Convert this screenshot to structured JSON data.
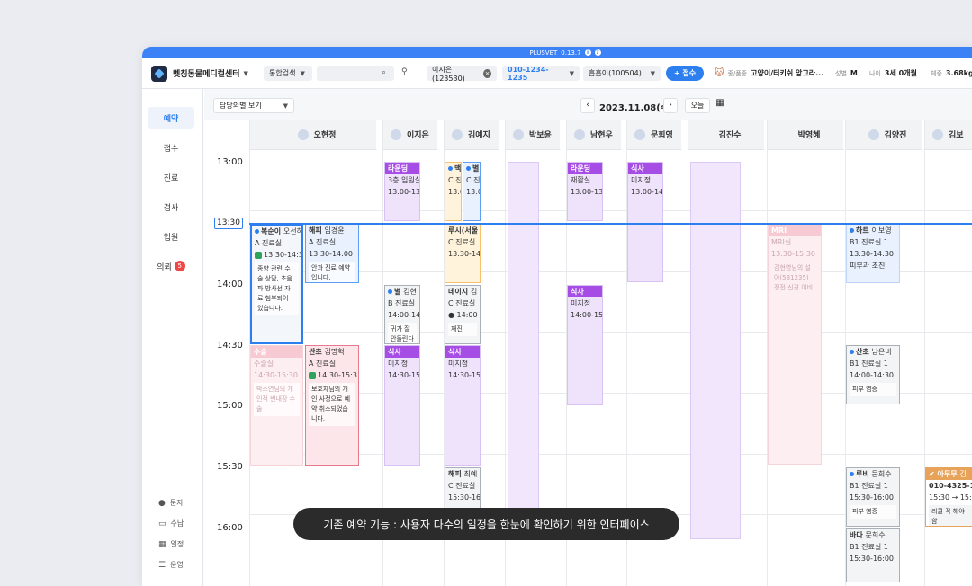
{
  "app": {
    "name": "PLUSVET",
    "version": "0.13.7"
  },
  "header": {
    "hospital": "벳칭동물메디컬센터",
    "search_type": "통합검색",
    "search_placeholder": "",
    "owner": "이지은(123530)",
    "phone": "010-1234-1235",
    "pet": "흡흡이(100504)",
    "add_label": "+ 접수",
    "species_label": "종/품종",
    "species_value": "고양이/터키쉬 앙고라...",
    "sex_label": "성별",
    "sex_value": "M",
    "age_label": "나이",
    "age_value": "3세 0개월",
    "weight_label": "체중",
    "weight_value": "3.68kg"
  },
  "sidebar": {
    "items": [
      {
        "label": "예약"
      },
      {
        "label": "접수"
      },
      {
        "label": "진료"
      },
      {
        "label": "검사"
      },
      {
        "label": "입원"
      },
      {
        "label": "의뢰",
        "badge": "5"
      }
    ],
    "sub_items": [
      {
        "label": "문자",
        "icon": "chat-icon"
      },
      {
        "label": "수납",
        "icon": "card-icon"
      },
      {
        "label": "일정",
        "icon": "calendar-icon"
      },
      {
        "label": "운영",
        "icon": "list-icon"
      }
    ]
  },
  "toolbar": {
    "view": "담당의별 보기",
    "date": "2023.11.08(수)",
    "today": "오늘"
  },
  "times": [
    "13:00",
    "13:30",
    "14:00",
    "14:30",
    "15:00",
    "15:30",
    "16:00"
  ],
  "now": "13:30",
  "doctors": [
    "오현정",
    "이지은",
    "김예지",
    "박보윤",
    "남현우",
    "문희영",
    "김진수",
    "박영혜",
    "김양진",
    "김보"
  ],
  "cards": {
    "c1": {
      "title": "복순이",
      "owner": "오선하",
      "room": "A 진료실",
      "time": "13:30-14:3",
      "note": "종양 관련 수술 상담, 초음파 방사선 자료 첨부되어 있습니다."
    },
    "c2": {
      "title": "해피",
      "owner": "임경윤",
      "room": "A 진료실",
      "time": "13:30-14:00",
      "note": "안과 진료 예약입니다."
    },
    "c3": {
      "title": "수술",
      "room": "수술실",
      "time": "14:30-15:30",
      "note": "박소연님의 개인적 변내장 수술"
    },
    "c4": {
      "title": "싼초",
      "owner": "김명혁",
      "room": "A 진료실",
      "time": "14:30-15:3",
      "note": "보호자님의 개인 사정으로 예약 취소되었습니다."
    },
    "c5": {
      "title": "라운딩",
      "room": "3층 입원실",
      "time": "13:00-13"
    },
    "c6": {
      "title": "별",
      "owner": "김현",
      "room": "B 진료실",
      "time": "14:00-14",
      "note": "귀가 잘 안들린다"
    },
    "c7": {
      "title": "식사",
      "room": "미지정",
      "time": "14:30-15"
    },
    "c8": {
      "title": "맥",
      "room": "C 진료",
      "time": "13:0"
    },
    "c9": {
      "title": "별",
      "room": "C 진",
      "time": "13:0"
    },
    "c10": {
      "title": "루시(서울",
      "room": "C 진료실",
      "time": "13:30-14"
    },
    "c11": {
      "title": "데이지",
      "owner": "김",
      "room": "C 진료실",
      "time": "14:00",
      "note": "재진"
    },
    "c12": {
      "title": "식사",
      "room": "미지정",
      "time": "14:30-15"
    },
    "c13": {
      "title": "해피",
      "owner": "최예",
      "room": "C 진료실",
      "time": "15:30-16"
    },
    "c14": {
      "title": "라운딩",
      "room": "재활실",
      "time": "13:00-13"
    },
    "c15": {
      "title": "식사",
      "room": "미지정",
      "time": "14:00-15"
    },
    "c16": {
      "title": "식사",
      "room": "미지정",
      "time": "13:00-14"
    },
    "c17": {
      "title": "MRI",
      "room": "MRI실",
      "time": "13:30-15:30",
      "note": "김현영님의 설아(531235) 정전 신경 이비"
    },
    "c18": {
      "title": "하트",
      "owner": "이보영",
      "room": "B1 진료실 1",
      "time": "13:30-14:30",
      "note": "피부과 초진"
    },
    "c19": {
      "title": "산초",
      "owner": "남은비",
      "room": "B1 진료실 1",
      "time": "14:00-14:30",
      "note": "피부 염증"
    },
    "c20": {
      "title": "루비",
      "owner": "문희수",
      "room": "B1 진료실 1",
      "time": "15:30-16:00",
      "note": "피부 염증"
    },
    "c21": {
      "title": "바다",
      "owner": "문희수",
      "room": "B1 진료실 1",
      "time": "15:30-16:00"
    },
    "c22": {
      "title": "아무무",
      "owner": "김",
      "phone": "010-4325-15",
      "time": "15:30 → 15:4",
      "note": "리쿨 꼭 해야함"
    }
  },
  "caption": "기존 예약 기능 : 사용자 다수의 일정을 한눈에 확인하기 위한 인터페이스",
  "colors": {
    "accent": "#2d7ff0",
    "purple": "#a64de6",
    "badge": "#f04848"
  }
}
